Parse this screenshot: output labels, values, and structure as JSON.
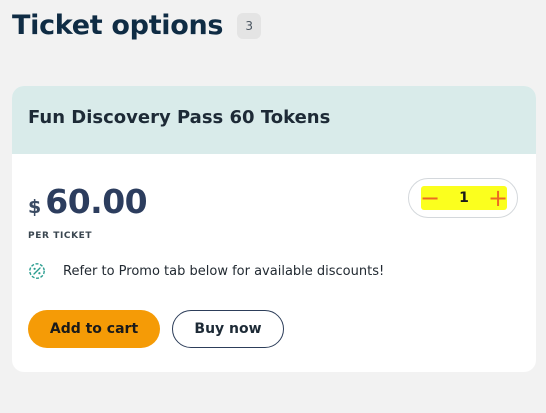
{
  "header": {
    "title": "Ticket options",
    "count": "3"
  },
  "ticket": {
    "name": "Fun Discovery Pass 60 Tokens",
    "currency_symbol": "$",
    "price": "60.00",
    "price_unit_label": "PER TICKET",
    "quantity": "1",
    "decrement_symbol": "−",
    "increment_symbol": "+",
    "promo_icon": "discount-percent-icon",
    "promo_text": "Refer to Promo tab below for available discounts!",
    "add_to_cart_label": "Add to cart",
    "buy_now_label": "Buy now"
  },
  "colors": {
    "title": "#0f2c44",
    "card_header_bg": "#d9ebea",
    "price": "#2c3d5e",
    "accent_orange": "#f59b06",
    "stepper_icons": "#ec6b22",
    "promo_icon": "#2a9d8f",
    "highlight": "#fbff1e"
  }
}
